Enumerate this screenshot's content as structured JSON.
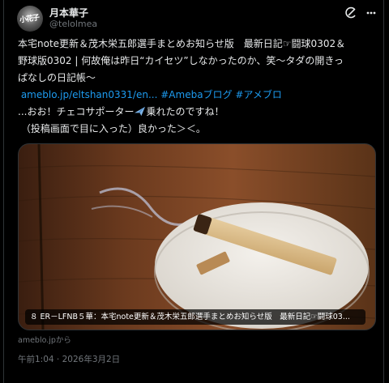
{
  "author": {
    "name": "月本華子",
    "handle": "@telolmea",
    "avatar_text": "小花子"
  },
  "tweet": {
    "line1": "本宅note更新＆茂木栄五郎選手まとめお知らせ版　最新日記☞闘球0302＆",
    "line2": "野球版0302 | 何故俺は昨日“カイセツ”しなかったのか、笑〜タダの開きっ",
    "line3": "ぱなしの日記帳〜",
    "link_url": "ameblo.jp/eltshan0331/en...",
    "hashtag1": "#Amebaブログ",
    "hashtag2": "#アメブロ",
    "line5a": "...おお！チェコサポーター",
    "line5b": "乗れたのですね！",
    "line6": "（投稿画面で目に入った）良かった＞＜。"
  },
  "media": {
    "caption": "８ ER－LFNB５華：本宅note更新＆茂木栄五郎選手まとめお知らせ版　最新日記☞闘球03..."
  },
  "source": "ameblo.jpから",
  "timestamp": "午前1:04 · 2026年3月2日",
  "icons": {
    "grok": "grok-icon",
    "more": "more-icon",
    "airplane": "airplane-emoji"
  }
}
